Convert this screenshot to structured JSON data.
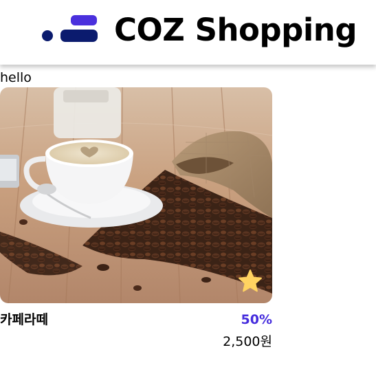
{
  "header": {
    "title": "COZ Shopping",
    "logo_icon": "coz-logo-icon"
  },
  "greeting": "hello",
  "product": {
    "name": "카페라떼",
    "discount": "50%",
    "price": "2,500원",
    "image_icon": "coffee-photo",
    "bookmark_icon": "star-icon",
    "bookmarked": true
  },
  "colors": {
    "accent": "#452CDD",
    "star": "#FFD361",
    "logo_dark": "#0B1B6E"
  }
}
